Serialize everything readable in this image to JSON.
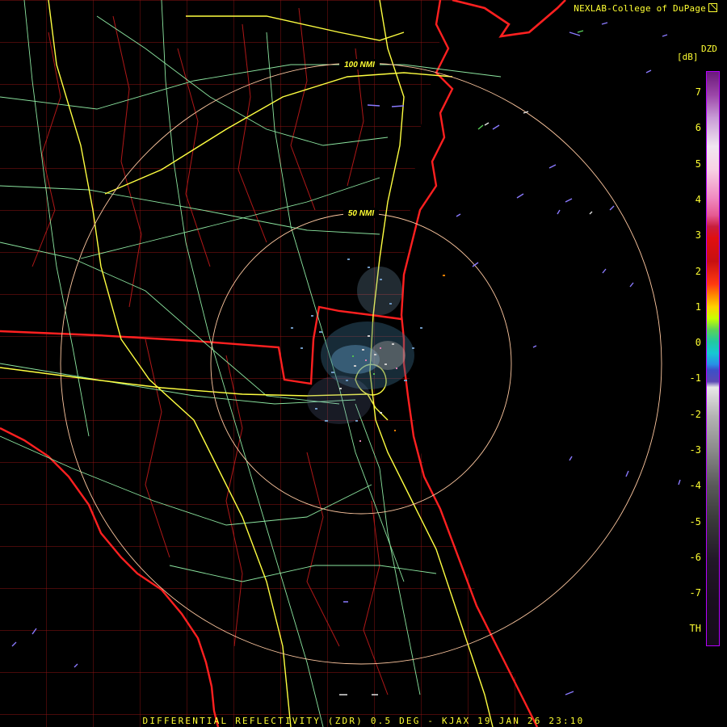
{
  "header": {
    "credit": "NEXLAB-College of DuPage"
  },
  "legend": {
    "product": "DZD",
    "unit": "[dB]",
    "ticks": [
      "7",
      "6",
      "5",
      "4",
      "3",
      "2",
      "1",
      "0",
      "-1",
      "-2",
      "-3",
      "-4",
      "-5",
      "-6",
      "-7",
      "TH"
    ]
  },
  "range_rings": [
    "100 NMI",
    "50 NMI"
  ],
  "footer": {
    "caption": "DIFFERENTIAL REFLECTIVITY (ZDR) 0.5 DEG - KJAX 19 JAN 26 23:10"
  },
  "colors": {
    "background": "#000000",
    "state_border": "#ff2020",
    "county_border": "#b01818",
    "highway": "#ffff40",
    "road": "#8ce6a0",
    "range_ring": "#ffc8a0",
    "label": "#ffff33"
  }
}
